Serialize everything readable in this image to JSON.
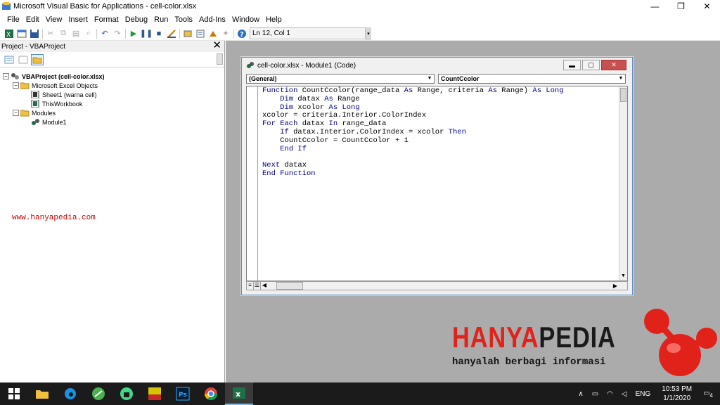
{
  "window": {
    "title": "Microsoft Visual Basic for Applications - cell-color.xlsx",
    "buttons": [
      "—",
      "❐",
      "✕"
    ]
  },
  "menu": [
    "File",
    "Edit",
    "View",
    "Insert",
    "Format",
    "Debug",
    "Run",
    "Tools",
    "Add-Ins",
    "Window",
    "Help"
  ],
  "toolbar": {
    "position": "Ln 12, Col 1"
  },
  "project": {
    "title": "Project - VBAProject",
    "close": "✕",
    "tree": {
      "root": "VBAProject (cell-color.xlsx)",
      "excel_objects": "Microsoft Excel Objects",
      "sheet1": "Sheet1 (warna cell)",
      "workbook": "ThisWorkbook",
      "modules": "Modules",
      "module1": "Module1"
    },
    "watermark": "www.hanyapedia.com"
  },
  "codewin": {
    "title": "cell-color.xlsx - Module1 (Code)",
    "object_combo": "(General)",
    "proc_combo": "CountCcolor",
    "lines": [
      [
        {
          "k": 1,
          "t": "Function"
        },
        {
          "k": 0,
          "t": " CountCcolor(range_data "
        },
        {
          "k": 1,
          "t": "As"
        },
        {
          "k": 0,
          "t": " Range, criteria "
        },
        {
          "k": 1,
          "t": "As"
        },
        {
          "k": 0,
          "t": " Range) "
        },
        {
          "k": 1,
          "t": "As Long"
        }
      ],
      [
        {
          "k": 0,
          "t": "    "
        },
        {
          "k": 1,
          "t": "Dim"
        },
        {
          "k": 0,
          "t": " datax "
        },
        {
          "k": 1,
          "t": "As"
        },
        {
          "k": 0,
          "t": " Range"
        }
      ],
      [
        {
          "k": 0,
          "t": "    "
        },
        {
          "k": 1,
          "t": "Dim"
        },
        {
          "k": 0,
          "t": " xcolor "
        },
        {
          "k": 1,
          "t": "As Long"
        }
      ],
      [
        {
          "k": 0,
          "t": "xcolor = criteria.Interior.ColorIndex"
        }
      ],
      [
        {
          "k": 1,
          "t": "For Each"
        },
        {
          "k": 0,
          "t": " datax "
        },
        {
          "k": 1,
          "t": "In"
        },
        {
          "k": 0,
          "t": " range_data"
        }
      ],
      [
        {
          "k": 0,
          "t": "    "
        },
        {
          "k": 1,
          "t": "If"
        },
        {
          "k": 0,
          "t": " datax.Interior.ColorIndex = xcolor "
        },
        {
          "k": 1,
          "t": "Then"
        }
      ],
      [
        {
          "k": 0,
          "t": "    CountCcolor = CountCcolor + 1"
        }
      ],
      [
        {
          "k": 0,
          "t": "    "
        },
        {
          "k": 1,
          "t": "End If"
        }
      ],
      [
        {
          "k": 0,
          "t": ""
        }
      ],
      [
        {
          "k": 1,
          "t": "Next"
        },
        {
          "k": 0,
          "t": " datax"
        }
      ],
      [
        {
          "k": 1,
          "t": "End Function"
        }
      ]
    ]
  },
  "logo": {
    "brand_a": "HANYA",
    "brand_b": "PEDIA",
    "tagline": "hanyalah berbagi informasi"
  },
  "taskbar": {
    "lang": "ENG",
    "time": "10:53 PM",
    "date": "1/1/2020",
    "notif_count": "4"
  },
  "colors": {
    "keyword": "#00008b",
    "mdi_bg": "#ababab",
    "taskbar": "#1b1b1b",
    "logo_red": "#e1221b"
  }
}
